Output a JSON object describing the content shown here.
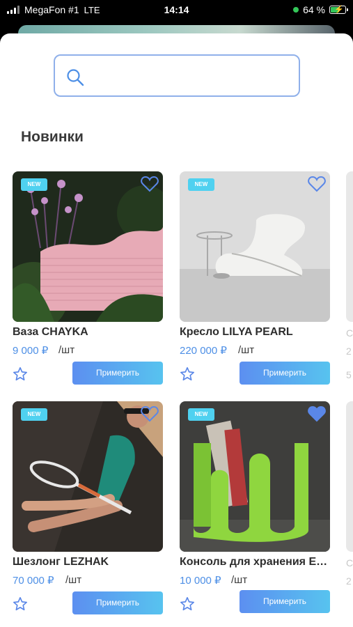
{
  "status_bar": {
    "carrier": "MegaFon #1",
    "network": "LTE",
    "time": "14:14",
    "battery": "64 %",
    "battery_level": 0.64,
    "location_dot_color": "#34c759"
  },
  "search": {
    "placeholder": "",
    "value": ""
  },
  "section": {
    "title": "Новинки"
  },
  "colors": {
    "accent": "#4d8fe6",
    "badge": "#4fd1f0"
  },
  "products": [
    {
      "badge": "NEW",
      "name": "Ваза CHAYKA",
      "price": "9 000 ₽",
      "unit": "/шт",
      "button": "Примерить",
      "favorite": false
    },
    {
      "badge": "NEW",
      "name": "Кресло LILYA PEARL",
      "price": "220 000 ₽",
      "unit": "/шт",
      "button": "Примерить",
      "favorite": false
    },
    {
      "badge": "NEW",
      "name": "Шезлонг LEZHAK",
      "price": "70 000 ₽",
      "unit": "/шт",
      "button": "Примерить",
      "favorite": false
    },
    {
      "badge": "NEW",
      "name": "Консоль для хранения EBUR...",
      "price": "10 000 ₽",
      "unit": "/шт",
      "button": "Примерить",
      "favorite": true
    }
  ],
  "peek_column": [
    "С",
    "2",
    "5",
    "С",
    "2"
  ]
}
